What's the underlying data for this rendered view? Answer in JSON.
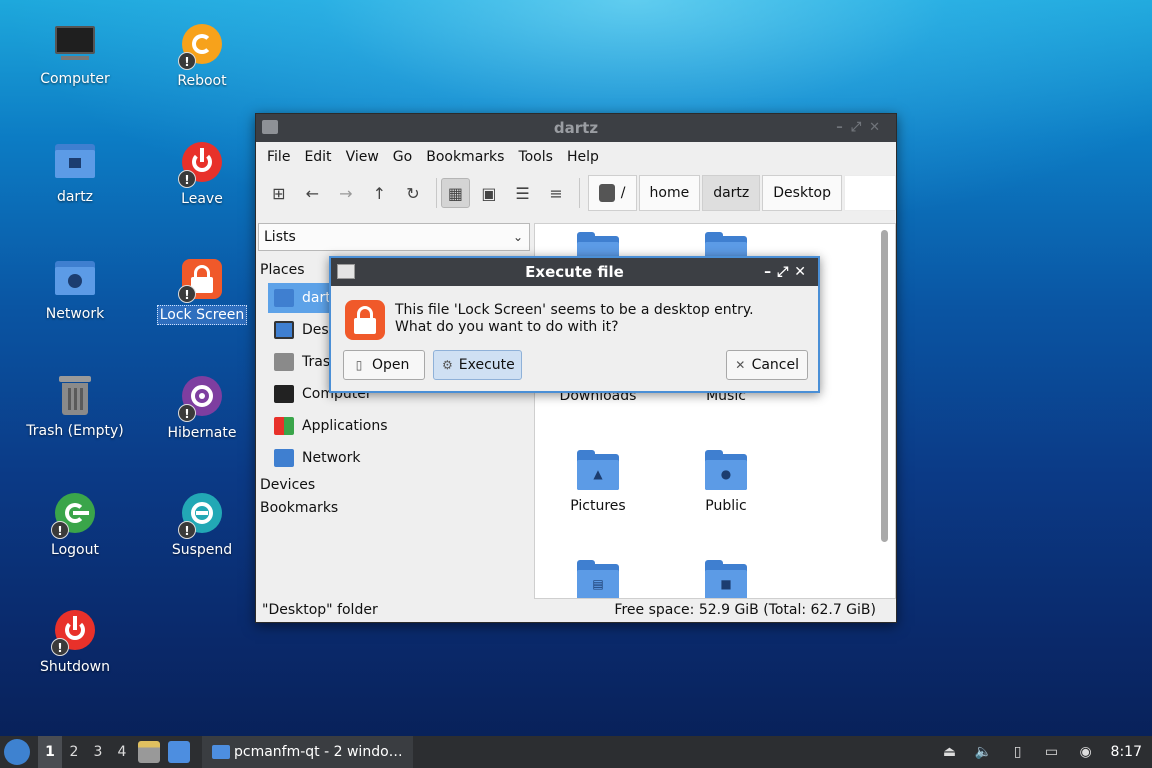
{
  "desktop": {
    "icons": [
      {
        "label": "Computer"
      },
      {
        "label": "Reboot"
      },
      {
        "label": "dartz"
      },
      {
        "label": "Leave"
      },
      {
        "label": "Network"
      },
      {
        "label": "Lock Screen"
      },
      {
        "label": "Trash (Empty)"
      },
      {
        "label": "Hibernate"
      },
      {
        "label": "Logout"
      },
      {
        "label": "Suspend"
      },
      {
        "label": "Shutdown"
      }
    ],
    "badge": "!"
  },
  "filemanager": {
    "title": "dartz",
    "menu": [
      "File",
      "Edit",
      "View",
      "Go",
      "Bookmarks",
      "Tools",
      "Help"
    ],
    "breadcrumbs": [
      "/",
      "home",
      "dartz",
      "Desktop"
    ],
    "sidebar": {
      "view_select": "Lists",
      "places_header": "Places",
      "items": [
        "dartz",
        "Desktop",
        "Trash",
        "Computer",
        "Applications",
        "Network"
      ],
      "devices_header": "Devices",
      "bookmarks_header": "Bookmarks"
    },
    "folders": [
      "Downloads",
      "Music",
      "Pictures",
      "Public"
    ],
    "status_left": "\"Desktop\" folder",
    "status_right": "Free space: 52.9 GiB (Total: 62.7 GiB)"
  },
  "dialog": {
    "title": "Execute file",
    "message_line1": "This file 'Lock Screen' seems to be a desktop entry.",
    "message_line2": "What do you want to do with it?",
    "open_label": "Open",
    "execute_label": "Execute",
    "cancel_label": "Cancel"
  },
  "taskbar": {
    "workspaces": [
      "1",
      "2",
      "3",
      "4"
    ],
    "task_label": "pcmanfm-qt - 2 windo…",
    "clock": "8:17"
  },
  "colors": {
    "accent": "#4a8fd6",
    "lock_orange": "#f0592a",
    "folder_blue": "#5c9be6"
  }
}
